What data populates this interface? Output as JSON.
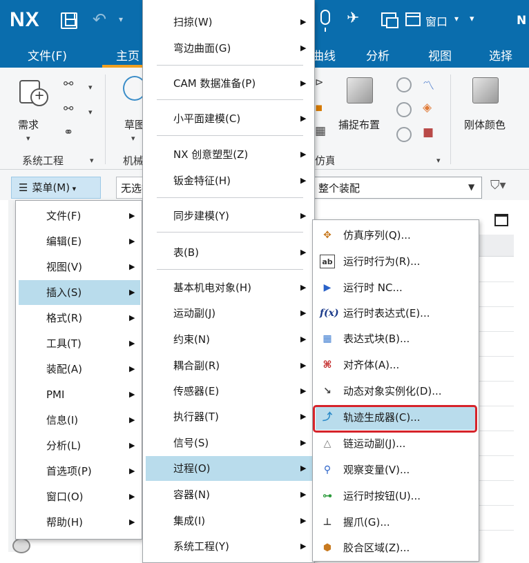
{
  "app": {
    "logo": "NX",
    "window_menu_label": "窗口",
    "title_right": "N"
  },
  "ribbon_tabs": {
    "file": "文件(F)",
    "home": "主页",
    "curve_partial": "曲线",
    "analysis": "分析",
    "view": "视图",
    "select": "选择"
  },
  "ribbon": {
    "requirements": "需求",
    "sketch_partial": "草图",
    "capture_layout": "捕捉布置",
    "body_color": "刚体颜色",
    "group_system_eng": "系统工程",
    "group_mech_partial": "机械",
    "group_sim_partial": "仿真"
  },
  "menubar": {
    "menu_button": "菜单(M)",
    "filter_value": "无选择过滤器",
    "scope_value": "整个装配"
  },
  "main_menu": [
    {
      "label": "文件(F)"
    },
    {
      "label": "编辑(E)"
    },
    {
      "label": "视图(V)"
    },
    {
      "label": "插入(S)"
    },
    {
      "label": "格式(R)"
    },
    {
      "label": "工具(T)"
    },
    {
      "label": "装配(A)"
    },
    {
      "label": "PMI"
    },
    {
      "label": "信息(I)"
    },
    {
      "label": "分析(L)"
    },
    {
      "label": "首选项(P)"
    },
    {
      "label": "窗口(O)"
    },
    {
      "label": "帮助(H)"
    }
  ],
  "insert_menu": [
    {
      "label": "扫掠(W)"
    },
    {
      "label": "弯边曲面(G)"
    },
    {
      "label": "CAM 数据准备(P)"
    },
    {
      "label": "小平面建模(C)"
    },
    {
      "label": "NX 创意塑型(Z)"
    },
    {
      "label": "钣金特征(H)"
    },
    {
      "label": "同步建模(Y)"
    },
    {
      "label": "表(B)"
    },
    {
      "label": "基本机电对象(H)"
    },
    {
      "label": "运动副(J)"
    },
    {
      "label": "约束(N)"
    },
    {
      "label": "耦合副(R)"
    },
    {
      "label": "传感器(E)"
    },
    {
      "label": "执行器(T)"
    },
    {
      "label": "信号(S)"
    },
    {
      "label": "过程(O)"
    },
    {
      "label": "容器(N)"
    },
    {
      "label": "集成(I)"
    },
    {
      "label": "系统工程(Y)"
    }
  ],
  "process_menu": [
    {
      "label": "仿真序列(Q)...",
      "icon": "sequence-icon"
    },
    {
      "label": "运行时行为(R)...",
      "icon": "behavior-icon"
    },
    {
      "label": "运行时 NC...",
      "icon": "nc-icon"
    },
    {
      "label": "运行时表达式(E)...",
      "icon": "expression-icon"
    },
    {
      "label": "表达式块(B)...",
      "icon": "expression-block-icon"
    },
    {
      "label": "对齐体(A)...",
      "icon": "align-body-icon"
    },
    {
      "label": "动态对象实例化(D)...",
      "icon": "dynamic-object-icon"
    },
    {
      "label": "轨迹生成器(C)...",
      "icon": "trajectory-generator-icon"
    },
    {
      "label": "链运动副(J)...",
      "icon": "chain-joint-icon"
    },
    {
      "label": "观察变量(V)...",
      "icon": "watch-variable-icon"
    },
    {
      "label": "运行时按钮(U)...",
      "icon": "runtime-button-icon"
    },
    {
      "label": "握爪(G)...",
      "icon": "gripper-icon"
    },
    {
      "label": "胶合区域(Z)...",
      "icon": "glue-region-icon"
    }
  ],
  "colors": {
    "title_bar": "#0a6dad",
    "accent": "#f0a020",
    "menu_highlight": "#b9dcec",
    "callout_red": "#d6232a"
  }
}
